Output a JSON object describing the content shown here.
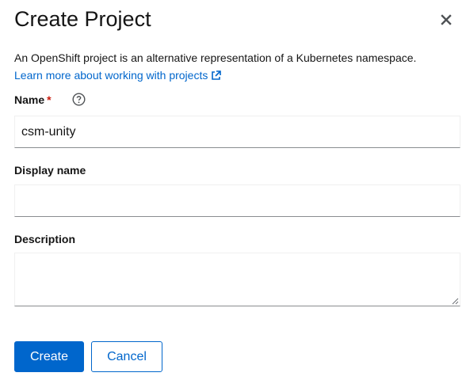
{
  "modal": {
    "title": "Create Project",
    "description": "An OpenShift project is an alternative representation of a Kubernetes namespace.",
    "learn_more_link": "Learn more about working with projects"
  },
  "form": {
    "name": {
      "label": "Name",
      "required_marker": "*",
      "value": "csm-unity"
    },
    "display_name": {
      "label": "Display name",
      "value": ""
    },
    "description": {
      "label": "Description",
      "value": ""
    }
  },
  "actions": {
    "create_label": "Create",
    "cancel_label": "Cancel"
  },
  "icons": {
    "close": "close-icon",
    "help": "question-circle-icon",
    "external_link": "external-link-icon",
    "resize": "resize-handle-icon"
  },
  "colors": {
    "primary": "#0066cc",
    "required": "#c9190b",
    "text": "#151515"
  }
}
